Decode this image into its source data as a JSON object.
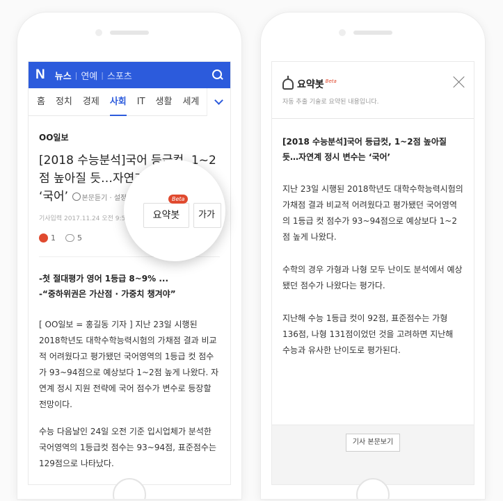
{
  "left": {
    "topbar": {
      "logo": "N",
      "services": [
        "뉴스",
        "연예",
        "스포츠"
      ]
    },
    "categories": [
      "홈",
      "정치",
      "경제",
      "사회",
      "IT",
      "생활",
      "세계"
    ],
    "active_category_index": 3,
    "article": {
      "press": "OO일보",
      "headline": "[2018 수능분석]국어 등급컷, 1~2점 높아질 듯…자연계 정시 변수는 ‘국어’",
      "listen_label": "본문듣기 · 설정",
      "datetime": "기사입력 2017.11.24 오전 9:50",
      "like_count": "1",
      "comment_count": "5",
      "summary_button": "요약봇",
      "beta": "Beta",
      "font_size_button": "가가",
      "subhead1": "-첫 절대평가 영어 1등급 8~9% ...",
      "subhead2": "-“중하위권은 가산점 · 가중치 챙겨야”",
      "para1": "[ OO일보 = 홍길동 기자 ] 지난 23일 시행된 2018학년도 대학수학능력시험의 가채점 결과 비교적 어려웠다고 평가됐던 국어영역의 1등급 컷 점수가 93~94점으로 예상보다 1~2점 높게 나왔다. 자연계 정시 지원 전략에 국어 점수가 변수로 등장할 전망이다.",
      "para2": "수능 다음날인 24일 오전 기준 입시업체가 분석한 국어영역의 1등급컷 점수는 93~94점, 표준점수는 129점으로 나타났다."
    }
  },
  "right": {
    "title": "요약봇",
    "beta": "Beta",
    "description": "자동 추출 기술로 요약된 내용입니다.",
    "headline": "[2018 수능분석]국어 등급컷, 1~2점 높아질 듯…자연계 정시 변수는 ‘국어’",
    "para1": "지난 23일 시행된 2018학년도 대학수학능력시험의 가채점 결과 비교적 어려웠다고 평가됐던 국어영역의 1등급 컷 점수가 93~94점으로 예상보다 1~2점 높게 나왔다.",
    "para2": "수학의 경우 가형과 나형 모두 난이도 분석에서 예상됐던 점수가 나왔다는 평가다.",
    "para3": "지난해 수능 1등급 컷이 92점, 표준점수는 가형 136점, 나형 131점이었던 것을 고려하면 지난해 수능과 유사한 난이도로 평가된다.",
    "view_article_button": "기사 본문보기"
  },
  "colors": {
    "naver_blue": "#2c5bdc",
    "accent_red": "#e04a2f"
  }
}
